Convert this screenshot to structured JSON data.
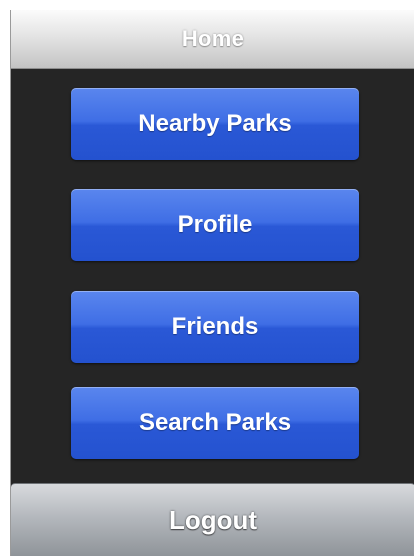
{
  "navbar": {
    "title": "Home"
  },
  "menu": {
    "items": [
      {
        "label": "Nearby Parks"
      },
      {
        "label": "Profile"
      },
      {
        "label": "Friends"
      },
      {
        "label": "Search Parks"
      }
    ]
  },
  "footer": {
    "logout_label": "Logout"
  },
  "colors": {
    "button_blue": "#3f6ee5",
    "background": "#252525",
    "navbar": "#e4e4e4",
    "logout_bar": "#b4b8bd"
  }
}
